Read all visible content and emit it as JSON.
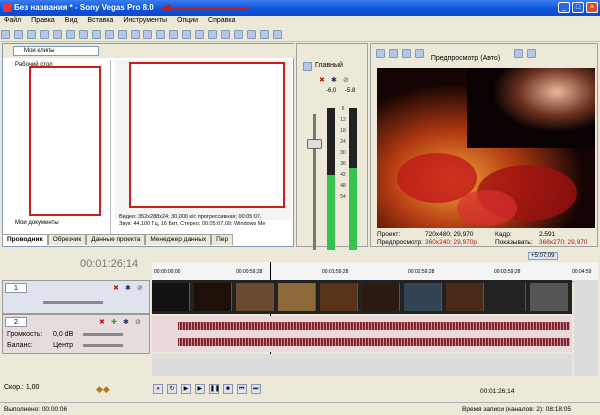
{
  "window": {
    "title": "Без названия * - Sony Vegas Pro 8.0",
    "minimize": "_",
    "maximize": "□",
    "close": "×"
  },
  "menu": [
    "Файл",
    "Правка",
    "Вид",
    "Вставка",
    "Инструменты",
    "Опции",
    "Справка"
  ],
  "explorer": {
    "combo_value": "Мои клипы",
    "tree_item_root": "Рабочий стол",
    "tree_item_docs": "Мои документы",
    "file_info_line1": "Видео: 352x288x24; 30,000 к/с прогрессивная; 00:05:07,",
    "file_info_line2": "Звук: 44.100 Гц, 16 Бит, Стерео; 00:05:07,09; Windows Me"
  },
  "tabs": [
    "Проводник",
    "Обрезчик",
    "Данные проекта",
    "Менеджер данных",
    "Пер"
  ],
  "mixer": {
    "label": "Главный",
    "peak_left": "-6.0",
    "peak_right": "-5.8",
    "ticks": [
      "6",
      "12",
      "18",
      "24",
      "30",
      "36",
      "42",
      "48",
      "54"
    ],
    "level_left_fraction": 0.62,
    "level_right_fraction": 0.66
  },
  "preview": {
    "mode": "Предпросмотр (Авто)",
    "project_label": "Проект:",
    "project_value": "720x480; 29,970",
    "frame_label": "Кадр:",
    "frame_value": "2.591",
    "preview_label": "Предпросмотр:",
    "preview_value": "360x240; 29,970p",
    "display_label": "Показывать:",
    "display_value": "368x270; 29,970"
  },
  "timeline": {
    "timecode": "00:01:26;14",
    "end_marker": "+5:07;09",
    "ruler_labels": [
      "00:00:00;00",
      "00:00:59;28",
      "00:01:59;28",
      "00:02:59;28",
      "00:03:59;28",
      "00:04:59"
    ],
    "playhead_label": "00:00:59;28",
    "video_track_number": "1",
    "audio_track_number": "2",
    "volume_label": "Громкость:",
    "volume_value": "0,0 dB",
    "pan_label": "Баланс:",
    "pan_value": "Центр",
    "rate_label": "Скор.: 1,00",
    "cursor_time": "00:01:26;14"
  },
  "status": {
    "left": "Выполнено: 00:00:06",
    "right": "Время записи (каналов: 2): 08:18:05"
  },
  "colors": {
    "titlebar": "#0a52d8",
    "meter_green": "#34c34c",
    "wave": "#8b2830",
    "annotation_red": "#cc1d1d"
  }
}
